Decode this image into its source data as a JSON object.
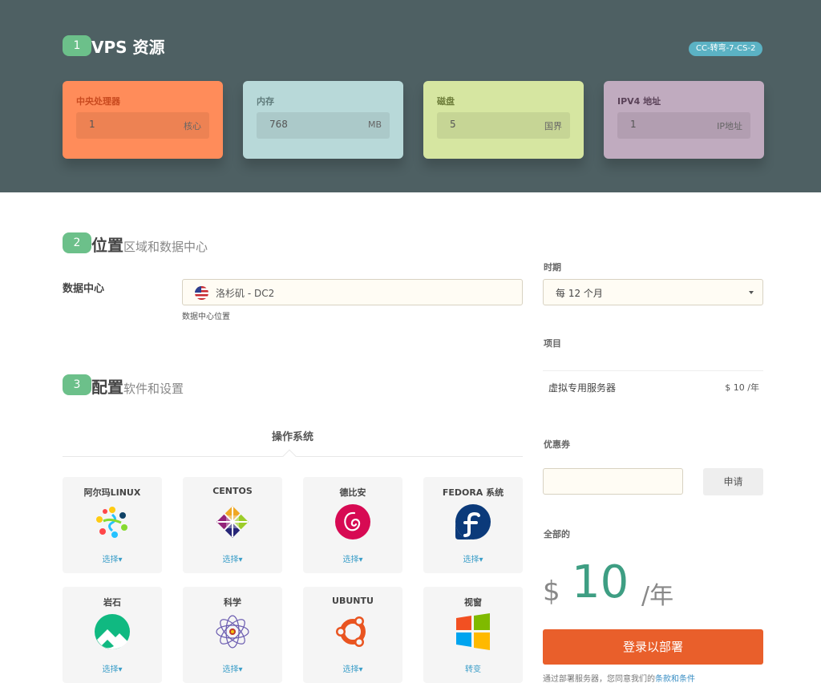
{
  "header": {
    "step_number": "1",
    "title": "VPS 资源",
    "badge": "CC-转弯-7-CS-2"
  },
  "resources": [
    {
      "label": "中央处理器",
      "value": "1",
      "unit": "核心",
      "color": "#ff8c5a"
    },
    {
      "label": "内存",
      "value": "768",
      "unit": "MB",
      "color": "#b8d9d9"
    },
    {
      "label": "磁盘",
      "value": "5",
      "unit": "国界",
      "color": "#d6e6a1"
    },
    {
      "label": "IPV4 地址",
      "value": "1",
      "unit": "IP地址",
      "color": "#c0abbf"
    }
  ],
  "location": {
    "step_number": "2",
    "title": "位置",
    "subtitle": "区域和数据中心",
    "datacenter_label": "数据中心",
    "datacenter_value": "洛杉矶 - DC2",
    "datacenter_help": "数据中心位置",
    "flag_icon": "us-flag-icon"
  },
  "config": {
    "step_number": "3",
    "title": "配置",
    "subtitle": "软件和设置",
    "os_tab": "操作系统",
    "os_list": [
      {
        "name": "阿尔玛LINUX",
        "action": "选择▾",
        "icon": "almalinux-icon"
      },
      {
        "name": "CENTOS",
        "action": "选择▾",
        "icon": "centos-icon"
      },
      {
        "name": "德比安",
        "action": "选择▾",
        "icon": "debian-icon"
      },
      {
        "name": "FEDORA 系统",
        "action": "选择▾",
        "icon": "fedora-icon"
      },
      {
        "name": "岩石",
        "action": "选择▾",
        "icon": "rocky-icon"
      },
      {
        "name": "科学",
        "action": "选择▾",
        "icon": "scientific-icon"
      },
      {
        "name": "UBUNTU",
        "action": "选择▾",
        "icon": "ubuntu-icon"
      },
      {
        "name": "视窗",
        "action": "转变",
        "icon": "windows-icon"
      }
    ]
  },
  "summary": {
    "period_label": "时期",
    "period_value": "每 12 个月",
    "items_label": "项目",
    "item_name": "虚拟专用服务器",
    "item_price": "$ 10 /年",
    "coupon_label": "优惠券",
    "coupon_placeholder": "",
    "apply_label": "申请",
    "total_label": "全部的",
    "currency": "$",
    "total_amount": "10",
    "total_period": "/年",
    "order_label": "登录以部署",
    "terms_text": "通过部署服务器，您同意我们的",
    "terms_link": "条款和条件"
  }
}
